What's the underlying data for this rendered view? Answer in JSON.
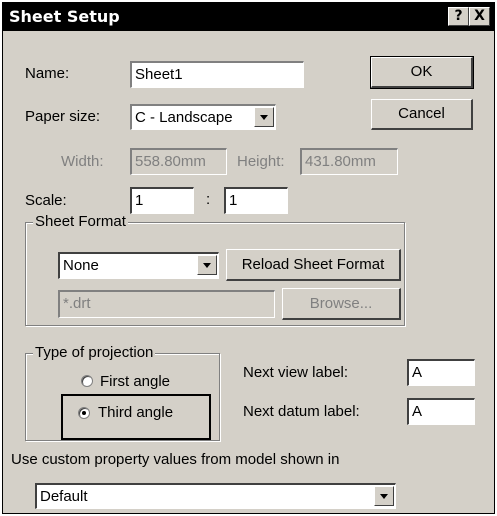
{
  "title": "Sheet Setup",
  "titlebar": {
    "help_label": "?",
    "close_label": "X"
  },
  "name": {
    "label": "Name:",
    "value": "Sheet1"
  },
  "buttons": {
    "ok": "OK",
    "cancel": "Cancel",
    "reload": "Reload Sheet Format",
    "browse": "Browse..."
  },
  "paper_size": {
    "label": "Paper size:",
    "value": "C - Landscape"
  },
  "width": {
    "label": "Width:",
    "value": "558.80mm"
  },
  "height": {
    "label": "Height:",
    "value": "431.80mm"
  },
  "scale": {
    "label": "Scale:",
    "separator": ":",
    "numerator": "1",
    "denominator": "1"
  },
  "sheet_format": {
    "title": "Sheet Format",
    "value": "None",
    "file": "*.drt"
  },
  "projection": {
    "title": "Type of projection",
    "first": "First angle",
    "third": "Third angle",
    "selected": "third"
  },
  "next_view": {
    "label": "Next view label:",
    "value": "A"
  },
  "next_datum": {
    "label": "Next datum label:",
    "value": "A"
  },
  "custom_property": {
    "label": "Use custom property values from model shown in",
    "value": "Default"
  }
}
